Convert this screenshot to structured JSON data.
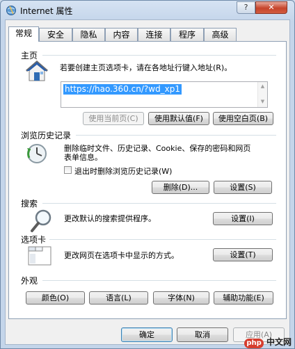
{
  "window": {
    "title": "Internet 属性",
    "help_glyph": "?",
    "close_glyph": "✕"
  },
  "tabs": [
    "常规",
    "安全",
    "隐私",
    "内容",
    "连接",
    "程序",
    "高级"
  ],
  "homepage": {
    "label": "主页",
    "description": "若要创建主页选项卡，请在各地址行键入地址(R)。",
    "url": "https://hao.360.cn/?wd_xp1",
    "use_current": "使用当前页(C)",
    "use_default": "使用默认值(F)",
    "use_blank": "使用空白页(B)"
  },
  "history": {
    "label": "浏览历史记录",
    "description_line1": "删除临时文件、历史记录、Cookie、保存的密码和网页",
    "description_line2": "表单信息。",
    "checkbox_label": "退出时删除浏览历史记录(W)",
    "checkbox_checked": false,
    "delete_button": "删除(D)...",
    "settings_button": "设置(S)"
  },
  "search": {
    "label": "搜索",
    "description": "更改默认的搜索提供程序。",
    "settings_button": "设置(I)"
  },
  "tabbed": {
    "label": "选项卡",
    "description": "更改网页在选项卡中显示的方式。",
    "settings_button": "设置(T)"
  },
  "appearance": {
    "label": "外观",
    "colors": "颜色(O)",
    "languages": "语言(L)",
    "fonts": "字体(N)",
    "accessibility": "辅助功能(E)"
  },
  "footer": {
    "ok": "确定",
    "cancel": "取消",
    "apply": "应用(A)"
  },
  "watermark": {
    "badge": "php",
    "text": "中文网"
  },
  "colors": {
    "selection": "#3399ff",
    "close_button": "#c6442b",
    "titlebar": "#c4d5ea"
  }
}
